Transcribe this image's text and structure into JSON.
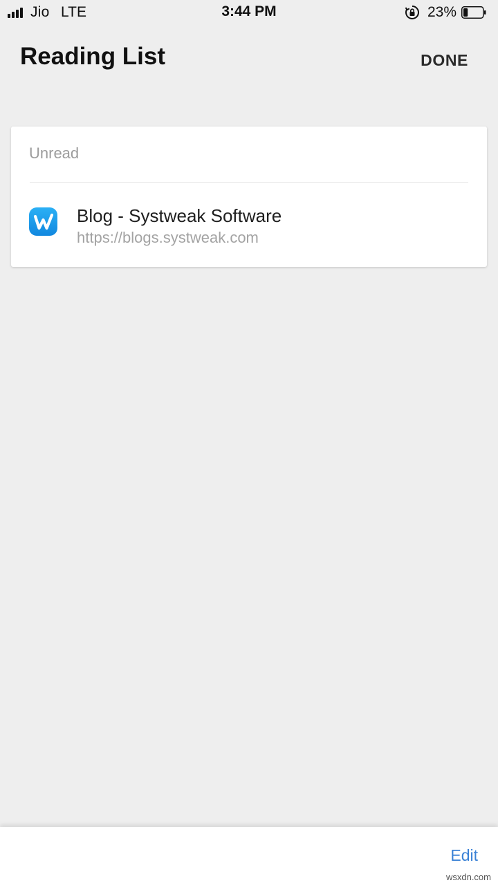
{
  "status_bar": {
    "carrier": "Jio",
    "network": "LTE",
    "time": "3:44 PM",
    "battery_percent": "23%",
    "battery_level": 0.23,
    "icons": [
      "signal-bars-icon",
      "orientation-lock-icon",
      "battery-icon"
    ]
  },
  "header": {
    "title": "Reading List",
    "done_label": "DONE"
  },
  "reading_list": {
    "section_label": "Unread",
    "items": [
      {
        "title": "Blog - Systweak Software",
        "url": "https://blogs.systweak.com",
        "icon": "systweak-w-logo-icon"
      }
    ]
  },
  "toolbar": {
    "edit_label": "Edit"
  },
  "colors": {
    "background": "#eeeeee",
    "card": "#ffffff",
    "accent": "#3b82d6",
    "secondary_text": "#9c9c9c",
    "favicon_blue": "#1e9be8"
  },
  "watermark": "wsxdn.com"
}
